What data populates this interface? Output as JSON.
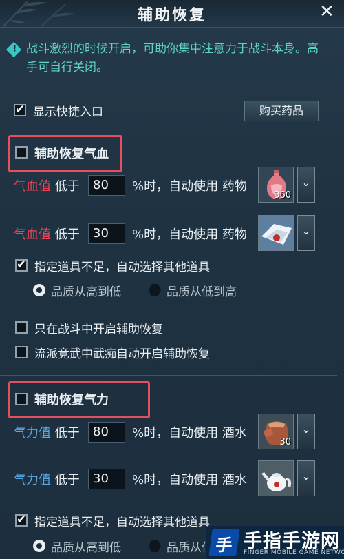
{
  "window": {
    "title": "辅助恢复"
  },
  "tip": "战斗激烈的时候开启，可助你集中注意力于战斗本身。高手可自行关闭。",
  "quick_entry": {
    "label": "显示快捷入口",
    "checked": true
  },
  "buy_button": "购买药品",
  "hp_section": {
    "title": "辅助恢复气血",
    "checked": false,
    "rows": [
      {
        "stat": "气血值",
        "below": "低于",
        "value": "80",
        "suffix": "%时，自动使用",
        "item_type": "药物",
        "item_icon": "red-potion-bottle-icon",
        "count": "360"
      },
      {
        "stat": "气血值",
        "below": "低于",
        "value": "30",
        "suffix": "%时，自动使用",
        "item_type": "药物",
        "item_icon": "white-cloth-medicine-icon",
        "count": ""
      }
    ],
    "fallback": {
      "label": "指定道具不足，自动选择其他道具",
      "checked": true
    },
    "quality_high": "品质从高到低",
    "quality_low": "品质从低到高",
    "combat_only": {
      "label": "只在战斗中开启辅助恢复",
      "checked": false
    },
    "arena": {
      "label": "流派竞武中武痴自动开启辅助恢复",
      "checked": false
    }
  },
  "mp_section": {
    "title": "辅助恢复气力",
    "checked": false,
    "rows": [
      {
        "stat": "气力值",
        "below": "低于",
        "value": "80",
        "suffix": "%时，自动使用",
        "item_type": "酒水",
        "item_icon": "wine-jar-icon",
        "count": "30"
      },
      {
        "stat": "气力值",
        "below": "低于",
        "value": "30",
        "suffix": "%时，自动使用",
        "item_type": "酒水",
        "item_icon": "white-teapot-icon",
        "count": ""
      }
    ],
    "fallback": {
      "label": "指定道具不足，自动选择其他道具",
      "checked": true
    },
    "quality_high": "品质从高到低",
    "quality_low": "品质从低到高"
  },
  "watermark": {
    "brand": "手指手游网",
    "logo_char": "手",
    "subtitle": "FINGER MOBILE GAME NETWORK"
  },
  "colors": {
    "hp_stat": "#e8475a",
    "mp_stat": "#5aa9e2",
    "tip": "#5fd4c6",
    "highlight": "#e5505e"
  }
}
